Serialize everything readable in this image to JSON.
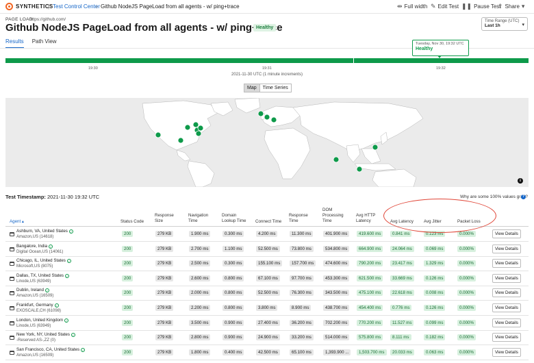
{
  "app": {
    "brand": "SYNTHETICS",
    "breadcrumb": [
      "Test Control Center",
      "Github NodeJS PageLoad from all agents - w/ ping+trace"
    ]
  },
  "toolbar": {
    "full_width": "Full width",
    "edit_test": "Edit Test",
    "pause_test": "Pause Test",
    "share": "Share"
  },
  "header": {
    "label": "PAGE LOAD",
    "url": "https://github.com/",
    "title": "Github NodeJS PageLoad from all agents - w/ ping+trace",
    "status": "Healthy",
    "time_range_label": "Time Range (UTC)",
    "time_range_value": "Last 1h"
  },
  "tabs": [
    "Results",
    "Path View"
  ],
  "timeline": {
    "ticks": [
      "19:30",
      "19:31",
      "19:32"
    ],
    "caption": "2021-11-30 UTC (1 minute increments)",
    "tooltip_date": "Tuesday, Nov 30, 19:32 UTC",
    "tooltip_status": "Healthy",
    "status_color": "#0e9a4a"
  },
  "view_toggle": [
    "Map",
    "Time Series"
  ],
  "timestamp": {
    "label": "Test Timestamp:",
    "value": "2021-11-30 19:32 UTC",
    "gray_question": "Why are some 100% values gray?"
  },
  "table": {
    "headers": {
      "agent": "Agent",
      "status_code": "Status Code",
      "response_size": [
        "Response",
        "Size"
      ],
      "navigation_time": [
        "Navigation",
        "Time"
      ],
      "domain_lookup": [
        "Domain",
        "Lookup Time"
      ],
      "connect_time": "Connect Time",
      "response_time": [
        "Response",
        "Time"
      ],
      "dom_processing": [
        "DOM",
        "Processing",
        "Time"
      ],
      "avg_http_latency": [
        "Avg HTTP",
        "Latency"
      ],
      "avg_latency": "Avg Latency",
      "avg_jitter": "Avg Jitter",
      "packet_loss": "Packet Loss"
    },
    "view_details_label": "View Details",
    "rows": [
      {
        "name": "Ashburn, VA, United States",
        "net": "Amazon,US (14618)",
        "status": "200",
        "size": "279 KB",
        "nav": "1.900 ms",
        "dns": "0.300 ms",
        "connect": "4.200 ms",
        "resp": "11.300 ms",
        "dom": "401.900 ms",
        "http": "419.600 ms",
        "latency": "0.841 ms",
        "jitter": "0.123 ms",
        "loss": "0.000%"
      },
      {
        "name": "Bangalore, India",
        "net": "Digital Ocean,US (14061)",
        "status": "200",
        "size": "279 KB",
        "nav": "2.700 ms",
        "dns": "1.100 ms",
        "connect": "52.500 ms",
        "resp": "73.800 ms",
        "dom": "534.800 ms",
        "http": "664.900 ms",
        "latency": "24.064 ms",
        "jitter": "0.069 ms",
        "loss": "0.000%"
      },
      {
        "name": "Chicago, IL, United States",
        "net": "Microsoft,US (8075)",
        "status": "200",
        "size": "279 KB",
        "nav": "2.500 ms",
        "dns": "0.300 ms",
        "connect": "155.100 ms",
        "resp": "157.700 ms",
        "dom": "474.600 ms",
        "http": "790.200 ms",
        "latency": "23.417 ms",
        "jitter": "1.329 ms",
        "loss": "0.000%"
      },
      {
        "name": "Dallas, TX, United States",
        "net": "Linode,US (63949)",
        "status": "200",
        "size": "279 KB",
        "nav": "2.600 ms",
        "dns": "0.800 ms",
        "connect": "67.100 ms",
        "resp": "97.700 ms",
        "dom": "453.300 ms",
        "http": "621.500 ms",
        "latency": "33.669 ms",
        "jitter": "0.126 ms",
        "loss": "0.000%"
      },
      {
        "name": "Dublin, Ireland",
        "net": "Amazon,US (16509)",
        "status": "200",
        "size": "279 KB",
        "nav": "2.000 ms",
        "dns": "0.800 ms",
        "connect": "52.500 ms",
        "resp": "76.300 ms",
        "dom": "343.500 ms",
        "http": "475.100 ms",
        "latency": "22.618 ms",
        "jitter": "0.008 ms",
        "loss": "0.000%"
      },
      {
        "name": "Frankfurt, Germany",
        "net": "EXOSCALE,CH (61098)",
        "status": "200",
        "size": "279 KB",
        "nav": "2.200 ms",
        "dns": "0.800 ms",
        "connect": "3.800 ms",
        "resp": "8.900 ms",
        "dom": "438.700 ms",
        "http": "454.400 ms",
        "latency": "0.776 ms",
        "jitter": "0.126 ms",
        "loss": "0.000%"
      },
      {
        "name": "London, United Kingdom",
        "net": "Linode,US (63949)",
        "status": "200",
        "size": "279 KB",
        "nav": "3.500 ms",
        "dns": "0.900 ms",
        "connect": "27.400 ms",
        "resp": "36.200 ms",
        "dom": "702.200 ms",
        "http": "770.200 ms",
        "latency": "11.527 ms",
        "jitter": "0.099 ms",
        "loss": "0.000%"
      },
      {
        "name": "New York, NY, United States",
        "net": "-Reserved AS-,ZZ (0)",
        "status": "200",
        "size": "279 KB",
        "nav": "2.800 ms",
        "dns": "0.900 ms",
        "connect": "24.900 ms",
        "resp": "33.200 ms",
        "dom": "514.000 ms",
        "http": "575.800 ms",
        "latency": "8.111 ms",
        "jitter": "0.182 ms",
        "loss": "0.000%"
      },
      {
        "name": "San Francisco, CA, United States",
        "net": "Amazon,US (16509)",
        "status": "200",
        "size": "279 KB",
        "nav": "1.800 ms",
        "dns": "0.400 ms",
        "connect": "42.500 ms",
        "resp": "65.100 ms",
        "dom": "1,393.900 ...",
        "http": "1,503.700 ms",
        "latency": "20.033 ms",
        "jitter": "0.063 ms",
        "loss": "0.000%"
      }
    ]
  },
  "colors": {
    "accent": "#1566c8",
    "healthy": "#0e9a4a",
    "annotation": "#e04436"
  }
}
